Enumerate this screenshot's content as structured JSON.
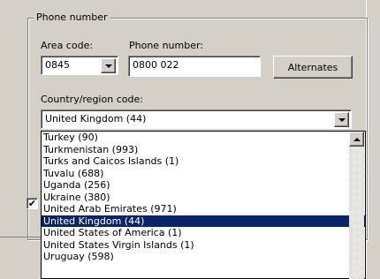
{
  "group": {
    "title": "Phone number"
  },
  "area_code": {
    "label": "Area code:",
    "value": "0845"
  },
  "phone_number": {
    "label": "Phone number:",
    "value": "0800 022"
  },
  "alternates_button": {
    "label": "Alternates"
  },
  "country": {
    "label": "Country/region code:",
    "selected": "United Kingdom (44)",
    "options": [
      "Turkey (90)",
      "Turkmenistan (993)",
      "Turks and Caicos Islands (1)",
      "Tuvalu (688)",
      "Uganda (256)",
      "Ukraine (380)",
      "United Arab Emirates (971)",
      "United Kingdom (44)",
      "United States of America (1)",
      "United States Virgin Islands (1)",
      "Uruguay (598)"
    ]
  },
  "checkbox": {
    "checked_glyph": "✔"
  }
}
